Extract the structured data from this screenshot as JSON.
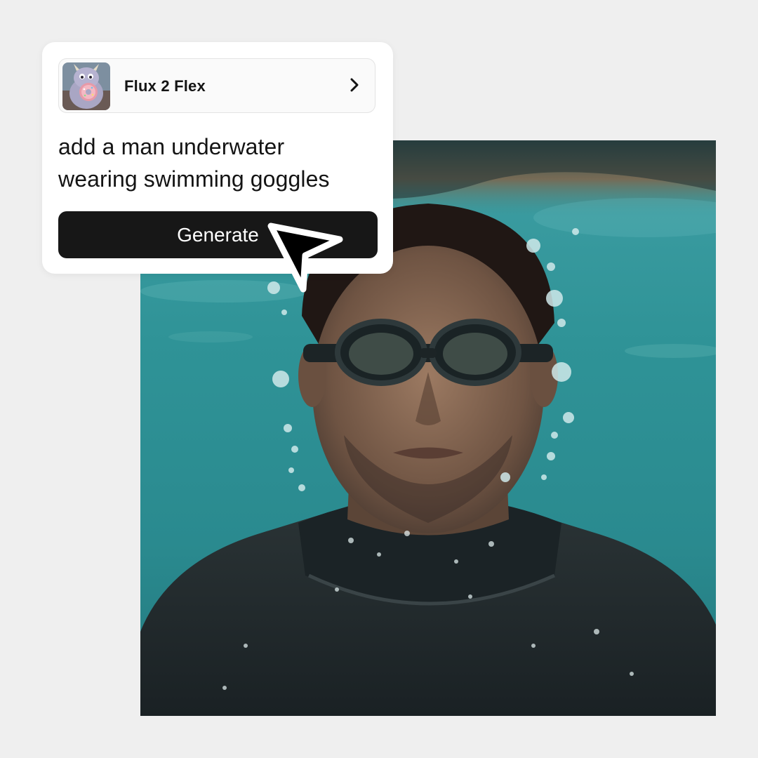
{
  "card": {
    "model_name": "Flux 2 Flex",
    "model_thumbnail_icon": "fluffy-monster-with-donut-thumbnail",
    "chevron_icon": "chevron-right-icon",
    "prompt_lines": [
      "add a man underwater",
      "wearing swimming goggles"
    ],
    "generate_label": "Generate"
  },
  "cursor_icon": "pointer-arrow-icon",
  "colors": {
    "page_background": "#efefef",
    "card_background": "#ffffff",
    "button_background": "#171717",
    "button_text": "#ffffff",
    "water": "#2f9397"
  }
}
